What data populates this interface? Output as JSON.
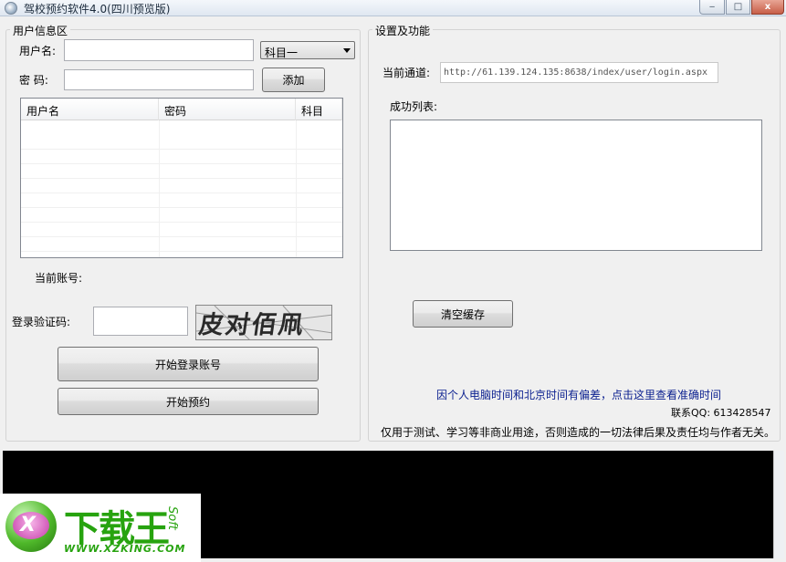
{
  "window": {
    "title": "驾校预约软件4.0(四川预览版)",
    "minimize_glyph": "‒",
    "maximize_glyph": "□",
    "close_glyph": "x"
  },
  "user_panel": {
    "legend": "用户信息区",
    "username_label": "用户名:",
    "username_value": "",
    "subject_selected": "科目一",
    "password_label": "密  码:",
    "password_value": "",
    "add_button": "添加",
    "table": {
      "columns": [
        "用户名",
        "密码",
        "科目"
      ],
      "rows": []
    },
    "current_account_label": "当前账号:",
    "captcha_label": "登录验证码:",
    "captcha_value": "",
    "captcha_image_text": "皮对佰凧",
    "start_login_button": "开始登录账号",
    "start_booking_button": "开始预约"
  },
  "settings_panel": {
    "legend": "设置及功能",
    "channel_label": "当前通道:",
    "channel_url": "http://61.139.124.135:8638/index/user/login.aspx",
    "success_list_label": "成功列表:",
    "clear_cache_button": "清空缓存",
    "time_notice_link": "因个人电脑时间和北京时间有偏差，点击这里查看准确时间",
    "contact_label": "联系QQ: 613428547",
    "disclaimer": "仅用于测试、学习等非商业用途，否则造成的一切法律后果及责任均与作者无关。"
  },
  "watermark": {
    "logo_letter": "X",
    "brand": "下载王",
    "soft": "Soft",
    "url": "WWW.XZKING.COM"
  },
  "colors": {
    "link": "#0a1f8f",
    "watermark_green": "#27a30f",
    "console_bg": "#000000"
  }
}
